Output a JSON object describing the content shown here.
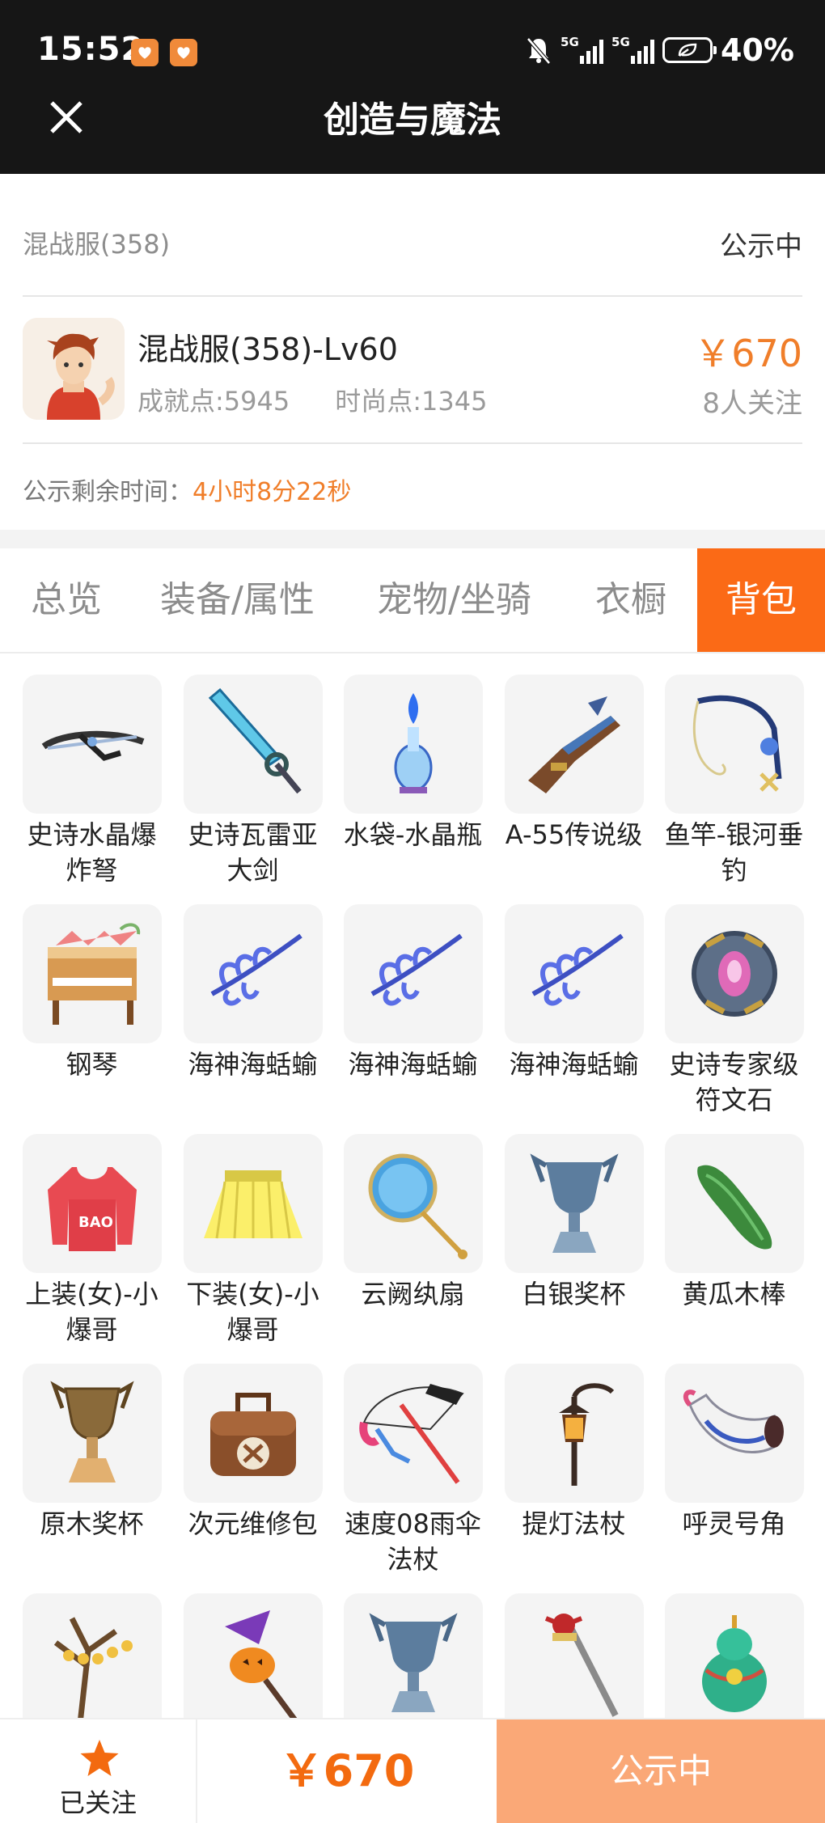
{
  "status_bar": {
    "time": "15:52",
    "network_1": "5G",
    "network_2": "5G",
    "battery": "40%"
  },
  "header": {
    "title": "创造与魔法",
    "close_icon": "close-icon"
  },
  "listing": {
    "server_name": "混战服(358)",
    "server_status": "公示中",
    "char_name": "混战服(358)-Lv60",
    "achievement": "成就点:5945",
    "fashion": "时尚点:1345",
    "price": "￥670",
    "followers": "8人关注",
    "timer_label": "公示剩余时间：",
    "timer_value": "4小时8分22秒"
  },
  "tabs": [
    {
      "label": "总览",
      "active": false
    },
    {
      "label": "装备/属性",
      "active": false
    },
    {
      "label": "宠物/坐骑",
      "active": false
    },
    {
      "label": "衣橱",
      "active": false
    },
    {
      "label": "背包",
      "active": true
    }
  ],
  "items": [
    {
      "name": "史诗水晶爆炸弩",
      "icon": "crossbow-icon"
    },
    {
      "name": "史诗瓦雷亚大剑",
      "icon": "sword-icon"
    },
    {
      "name": "水袋-水晶瓶",
      "icon": "crystal-bottle-icon"
    },
    {
      "name": "A-55传说级",
      "icon": "gun-icon"
    },
    {
      "name": "鱼竿-银河垂钓",
      "icon": "fishing-rod-icon"
    },
    {
      "name": "钢琴",
      "icon": "piano-icon"
    },
    {
      "name": "海神海蛞蝓",
      "icon": "sea-slug-icon"
    },
    {
      "name": "海神海蛞蝓",
      "icon": "sea-slug-icon"
    },
    {
      "name": "海神海蛞蝓",
      "icon": "sea-slug-icon"
    },
    {
      "name": "史诗专家级符文石",
      "icon": "rune-stone-icon"
    },
    {
      "name": "上装(女)-小爆哥",
      "icon": "hoodie-icon"
    },
    {
      "name": "下装(女)-小爆哥",
      "icon": "skirt-icon"
    },
    {
      "name": "云阙纨扇",
      "icon": "fan-icon"
    },
    {
      "name": "白银奖杯",
      "icon": "silver-trophy-icon"
    },
    {
      "name": "黄瓜木棒",
      "icon": "cucumber-icon"
    },
    {
      "name": "原木奖杯",
      "icon": "wood-trophy-icon"
    },
    {
      "name": "次元维修包",
      "icon": "repair-bag-icon"
    },
    {
      "name": "速度08雨伞法杖",
      "icon": "umbrella-icon"
    },
    {
      "name": "提灯法杖",
      "icon": "lantern-staff-icon"
    },
    {
      "name": "呼灵号角",
      "icon": "horn-icon"
    },
    {
      "name": "",
      "icon": "lantern-tree-icon"
    },
    {
      "name": "",
      "icon": "pumpkin-staff-icon"
    },
    {
      "name": "",
      "icon": "silver-trophy-icon"
    },
    {
      "name": "",
      "icon": "scepter-icon"
    },
    {
      "name": "",
      "icon": "gourd-icon"
    }
  ],
  "bottom_bar": {
    "follow_label": "已关注",
    "price": "￥670",
    "status_button": "公示中"
  },
  "colors": {
    "accent": "#fb6a16",
    "price": "#f07e2a",
    "status_button": "#faa877",
    "header_bg": "#161616"
  }
}
